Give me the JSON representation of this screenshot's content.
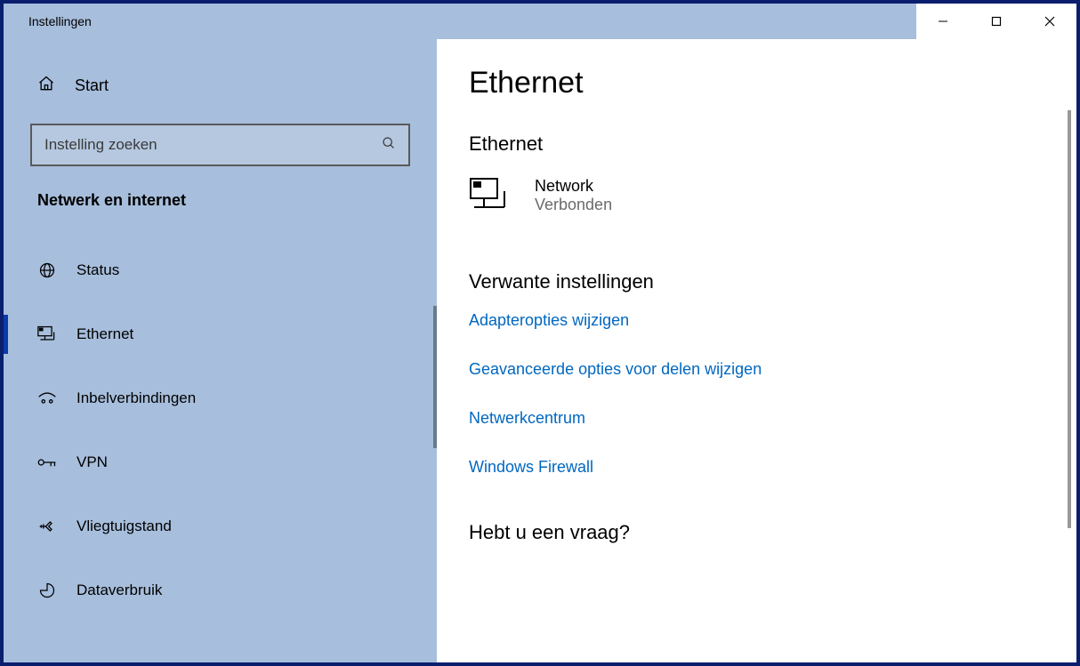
{
  "window": {
    "title": "Instellingen"
  },
  "sidebar": {
    "start_label": "Start",
    "search_placeholder": "Instelling zoeken",
    "category": "Netwerk en internet",
    "items": [
      {
        "label": "Status"
      },
      {
        "label": "Ethernet"
      },
      {
        "label": "Inbelverbindingen"
      },
      {
        "label": "VPN"
      },
      {
        "label": "Vliegtuigstand"
      },
      {
        "label": "Dataverbruik"
      }
    ]
  },
  "main": {
    "title": "Ethernet",
    "section": "Ethernet",
    "network": {
      "name": "Network",
      "status": "Verbonden"
    },
    "related_heading": "Verwante instellingen",
    "links": [
      {
        "label": "Adapteropties wijzigen"
      },
      {
        "label": "Geavanceerde opties voor delen wijzigen"
      },
      {
        "label": "Netwerkcentrum"
      },
      {
        "label": "Windows Firewall"
      }
    ],
    "question_heading": "Hebt u een vraag?"
  }
}
